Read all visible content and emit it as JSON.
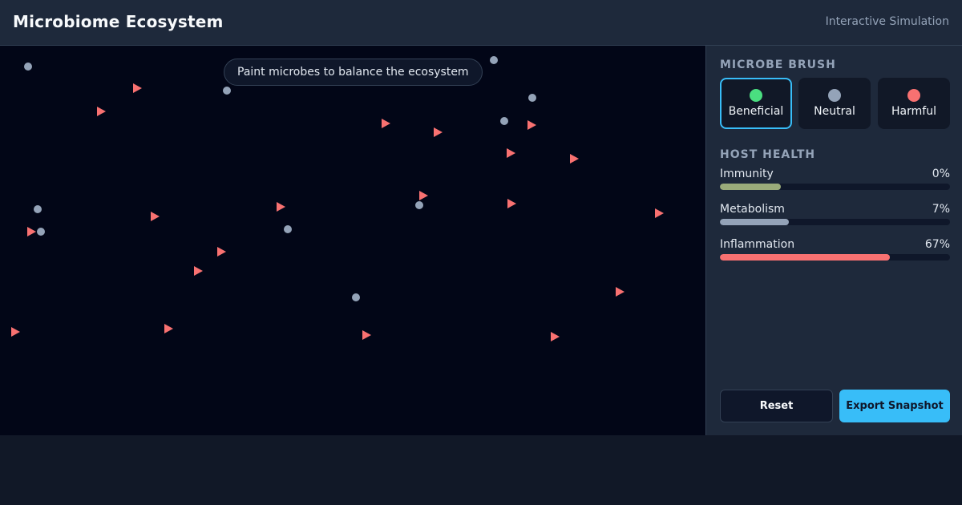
{
  "header": {
    "title": "Microbiome Ecosystem",
    "subtitle": "Interactive Simulation"
  },
  "canvas": {
    "hint": "Paint microbes to balance the ecosystem"
  },
  "brush": {
    "section_label": "MICROBE BRUSH",
    "selected": "beneficial",
    "options": [
      {
        "id": "beneficial",
        "label": "Beneficial",
        "color": "#4ade80"
      },
      {
        "id": "neutral",
        "label": "Neutral",
        "color": "#94a3b8"
      },
      {
        "id": "harmful",
        "label": "Harmful",
        "color": "#f87171"
      }
    ]
  },
  "health": {
    "section_label": "HOST HEALTH",
    "metrics": [
      {
        "label": "Immunity",
        "value": "0%",
        "fill_fraction": 0.265,
        "color": "#9aab7a"
      },
      {
        "label": "Metabolism",
        "value": "7%",
        "fill_fraction": 0.3,
        "color": "#94a3b8"
      },
      {
        "label": "Inflammation",
        "value": "67%",
        "fill_fraction": 0.74,
        "color": "#f87171"
      }
    ]
  },
  "actions": {
    "reset_label": "Reset",
    "export_label": "Export Snapshot"
  },
  "colors": {
    "accent": "#38bdf8",
    "neutral_microbe": "#94a3b8",
    "harmful_microbe": "#f87171"
  }
}
